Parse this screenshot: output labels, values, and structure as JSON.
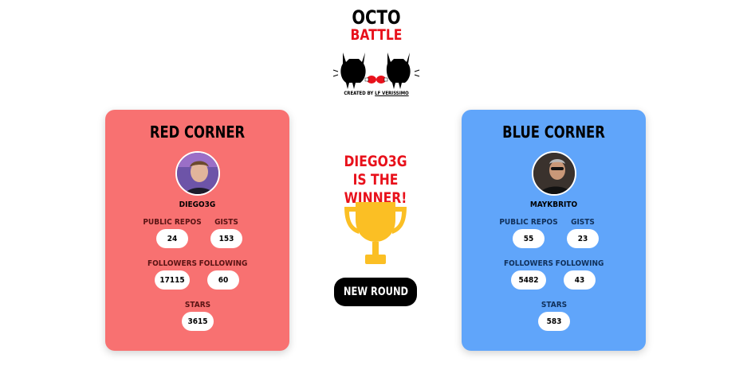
{
  "logo": {
    "line1": "OCTO",
    "line2": "BATTLE",
    "credit_prefix": "CREATED BY ",
    "credit_name": "LF VERISSIMO"
  },
  "colors": {
    "red_card": "#f87171",
    "blue_card": "#60a5fa",
    "accent_red": "#e8111b",
    "trophy": "#fbbf24"
  },
  "red": {
    "title": "RED CORNER",
    "username": "DIEGO3G",
    "labels": {
      "repos": "PUBLIC REPOS",
      "gists": "GISTS",
      "followers": "FOLLOWERS",
      "following": "FOLLOWING",
      "stars": "STARS"
    },
    "values": {
      "repos": "24",
      "gists": "153",
      "followers": "17115",
      "following": "60",
      "stars": "3615"
    }
  },
  "blue": {
    "title": "BLUE CORNER",
    "username": "MAYKBRITO",
    "labels": {
      "repos": "PUBLIC REPOS",
      "gists": "GISTS",
      "followers": "FOLLOWERS",
      "following": "FOLLOWING",
      "stars": "STARS"
    },
    "values": {
      "repos": "55",
      "gists": "23",
      "followers": "5482",
      "following": "43",
      "stars": "583"
    }
  },
  "result": {
    "winner_name": "DIEGO3G",
    "winner_text": "IS THE WINNER!",
    "button_label": "NEW ROUND",
    "trophy_icon": "trophy-icon"
  }
}
